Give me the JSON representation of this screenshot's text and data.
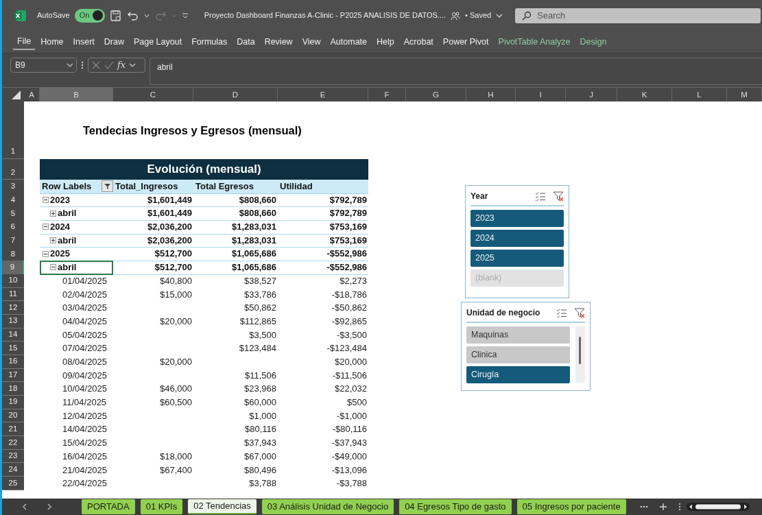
{
  "window": {
    "autosave": {
      "label": "AutoSave",
      "toggle_text": "On",
      "on": true
    },
    "title": "Proyecto Dashboard Finanzas A-Clinic - P2025 ANALISIS DE DATOS....",
    "save_status": "• Saved",
    "search": {
      "placeholder": "Search"
    }
  },
  "ribbon_tabs": [
    {
      "label": "File",
      "kind": "file"
    },
    {
      "label": "Home",
      "kind": "standard"
    },
    {
      "label": "Insert",
      "kind": "standard"
    },
    {
      "label": "Draw",
      "kind": "standard"
    },
    {
      "label": "Page Layout",
      "kind": "standard"
    },
    {
      "label": "Formulas",
      "kind": "standard"
    },
    {
      "label": "Data",
      "kind": "standard"
    },
    {
      "label": "Review",
      "kind": "standard"
    },
    {
      "label": "View",
      "kind": "standard"
    },
    {
      "label": "Automate",
      "kind": "standard"
    },
    {
      "label": "Help",
      "kind": "standard"
    },
    {
      "label": "Acrobat",
      "kind": "standard"
    },
    {
      "label": "Power Pivot",
      "kind": "standard"
    },
    {
      "label": "PivotTable Analyze",
      "kind": "contextual"
    },
    {
      "label": "Design",
      "kind": "contextual"
    }
  ],
  "formula_bar": {
    "name_box": "B9",
    "function_label": "fx",
    "formula": "abril"
  },
  "columns": [
    {
      "label": "A",
      "selected": false
    },
    {
      "label": "B",
      "selected": true
    },
    {
      "label": "C",
      "selected": false
    },
    {
      "label": "D",
      "selected": false
    },
    {
      "label": "E",
      "selected": false
    },
    {
      "label": "F",
      "selected": false
    },
    {
      "label": "G",
      "selected": false
    },
    {
      "label": "H",
      "selected": false
    },
    {
      "label": "I",
      "selected": false
    },
    {
      "label": "J",
      "selected": false
    },
    {
      "label": "K",
      "selected": false
    },
    {
      "label": "L",
      "selected": false
    },
    {
      "label": "M",
      "selected": false
    }
  ],
  "row_headers": [
    {
      "label": "1",
      "selected": false
    },
    {
      "label": "2",
      "selected": false
    },
    {
      "label": "3",
      "selected": false
    },
    {
      "label": "4",
      "selected": false
    },
    {
      "label": "5",
      "selected": false
    },
    {
      "label": "6",
      "selected": false
    },
    {
      "label": "7",
      "selected": false
    },
    {
      "label": "8",
      "selected": false
    },
    {
      "label": "9",
      "selected": true
    },
    {
      "label": "10",
      "selected": false
    },
    {
      "label": "11",
      "selected": false
    },
    {
      "label": "12",
      "selected": false
    },
    {
      "label": "13",
      "selected": false
    },
    {
      "label": "14",
      "selected": false
    },
    {
      "label": "15",
      "selected": false
    },
    {
      "label": "16",
      "selected": false
    },
    {
      "label": "17",
      "selected": false
    },
    {
      "label": "18",
      "selected": false
    },
    {
      "label": "19",
      "selected": false
    },
    {
      "label": "20",
      "selected": false
    },
    {
      "label": "21",
      "selected": false
    },
    {
      "label": "22",
      "selected": false
    },
    {
      "label": "23",
      "selected": false
    },
    {
      "label": "24",
      "selected": false
    },
    {
      "label": "25",
      "selected": false
    }
  ],
  "sheet_title": "Tendecias Ingresos y Egresos (mensual)",
  "pivot": {
    "title": "Evolución (mensual)",
    "headers": [
      "Row Labels",
      "Total_Ingresos",
      "Total Egresos",
      "Utilidad"
    ],
    "rows": [
      {
        "label": "2023",
        "expanded": true,
        "selected": false,
        "total_ingresos": "$1,601,449",
        "total_egresos": "$808,660",
        "utilidad": "$792,789",
        "children": [
          {
            "label": "abril",
            "expanded": false,
            "selected": false,
            "total_ingresos": "$1,601,449",
            "total_egresos": "$808,660",
            "utilidad": "$792,789"
          }
        ]
      },
      {
        "label": "2024",
        "expanded": true,
        "selected": false,
        "total_ingresos": "$2,036,200",
        "total_egresos": "$1,283,031",
        "utilidad": "$753,169",
        "children": [
          {
            "label": "abril",
            "expanded": false,
            "selected": false,
            "total_ingresos": "$2,036,200",
            "total_egresos": "$1,283,031",
            "utilidad": "$753,169"
          }
        ]
      },
      {
        "label": "2025",
        "expanded": true,
        "selected": false,
        "total_ingresos": "$512,700",
        "total_egresos": "$1,065,686",
        "utilidad": "-$552,986",
        "children": [
          {
            "label": "abril",
            "expanded": true,
            "selected": true,
            "total_ingresos": "$512,700",
            "total_egresos": "$1,065,686",
            "utilidad": "-$552,986",
            "children": [
              {
                "label": "01/04/2025",
                "selected": false,
                "total_ingresos": "$40,800",
                "total_egresos": "$38,527",
                "utilidad": "$2,273"
              },
              {
                "label": "02/04/2025",
                "selected": false,
                "total_ingresos": "$15,000",
                "total_egresos": "$33,786",
                "utilidad": "-$18,786"
              },
              {
                "label": "03/04/2025",
                "selected": false,
                "total_egresos": "$50,862",
                "utilidad": "-$50,862"
              },
              {
                "label": "04/04/2025",
                "selected": false,
                "total_ingresos": "$20,000",
                "total_egresos": "$112,865",
                "utilidad": "-$92,865"
              },
              {
                "label": "05/04/2025",
                "selected": false,
                "total_egresos": "$3,500",
                "utilidad": "-$3,500"
              },
              {
                "label": "07/04/2025",
                "selected": false,
                "total_egresos": "$123,484",
                "utilidad": "-$123,484"
              },
              {
                "label": "08/04/2025",
                "selected": false,
                "total_ingresos": "$20,000",
                "utilidad": "$20,000"
              },
              {
                "label": "09/04/2025",
                "selected": false,
                "total_egresos": "$11,506",
                "utilidad": "-$11,506"
              },
              {
                "label": "10/04/2025",
                "selected": false,
                "total_ingresos": "$46,000",
                "total_egresos": "$23,968",
                "utilidad": "$22,032"
              },
              {
                "label": "11/04/2025",
                "selected": false,
                "total_ingresos": "$60,500",
                "total_egresos": "$60,000",
                "utilidad": "$500"
              },
              {
                "label": "12/04/2025",
                "selected": false,
                "total_egresos": "$1,000",
                "utilidad": "-$1,000"
              },
              {
                "label": "14/04/2025",
                "selected": false,
                "total_egresos": "$80,116",
                "utilidad": "-$80,116"
              },
              {
                "label": "15/04/2025",
                "selected": false,
                "total_egresos": "$37,943",
                "utilidad": "-$37,943"
              },
              {
                "label": "16/04/2025",
                "selected": false,
                "total_ingresos": "$18,000",
                "total_egresos": "$67,000",
                "utilidad": "-$49,000"
              },
              {
                "label": "21/04/2025",
                "selected": false,
                "total_ingresos": "$67,400",
                "total_egresos": "$80,496",
                "utilidad": "-$13,096"
              },
              {
                "label": "22/04/2025",
                "selected": false,
                "total_egresos": "$3,788",
                "utilidad": "-$3,788"
              }
            ]
          }
        ]
      }
    ]
  },
  "slicers": [
    {
      "title": "Year",
      "scrollbar": false,
      "items": [
        {
          "label": "2023",
          "selected": true,
          "disabled": false
        },
        {
          "label": "2024",
          "selected": true,
          "disabled": false
        },
        {
          "label": "2025",
          "selected": true,
          "disabled": false
        },
        {
          "label": "(blank)",
          "selected": false,
          "disabled": true
        }
      ]
    },
    {
      "title": "Unidad de negocio",
      "scrollbar": true,
      "items": [
        {
          "label": "Maquinas",
          "selected": false,
          "disabled": false
        },
        {
          "label": "Clinica",
          "selected": false,
          "disabled": false
        },
        {
          "label": "Cirugía",
          "selected": true,
          "disabled": false
        }
      ]
    }
  ],
  "sheet_tabs": [
    {
      "label": "PORTADA",
      "selected": false
    },
    {
      "label": "01 KPIs",
      "selected": false
    },
    {
      "label": "02 Tendencias",
      "selected": true
    },
    {
      "label": "03 Análisis Unidad de Negocio",
      "selected": false
    },
    {
      "label": "04 Egresos Tipo de gasto",
      "selected": false
    },
    {
      "label": "05 Ingresos por paciente",
      "selected": false
    }
  ]
}
